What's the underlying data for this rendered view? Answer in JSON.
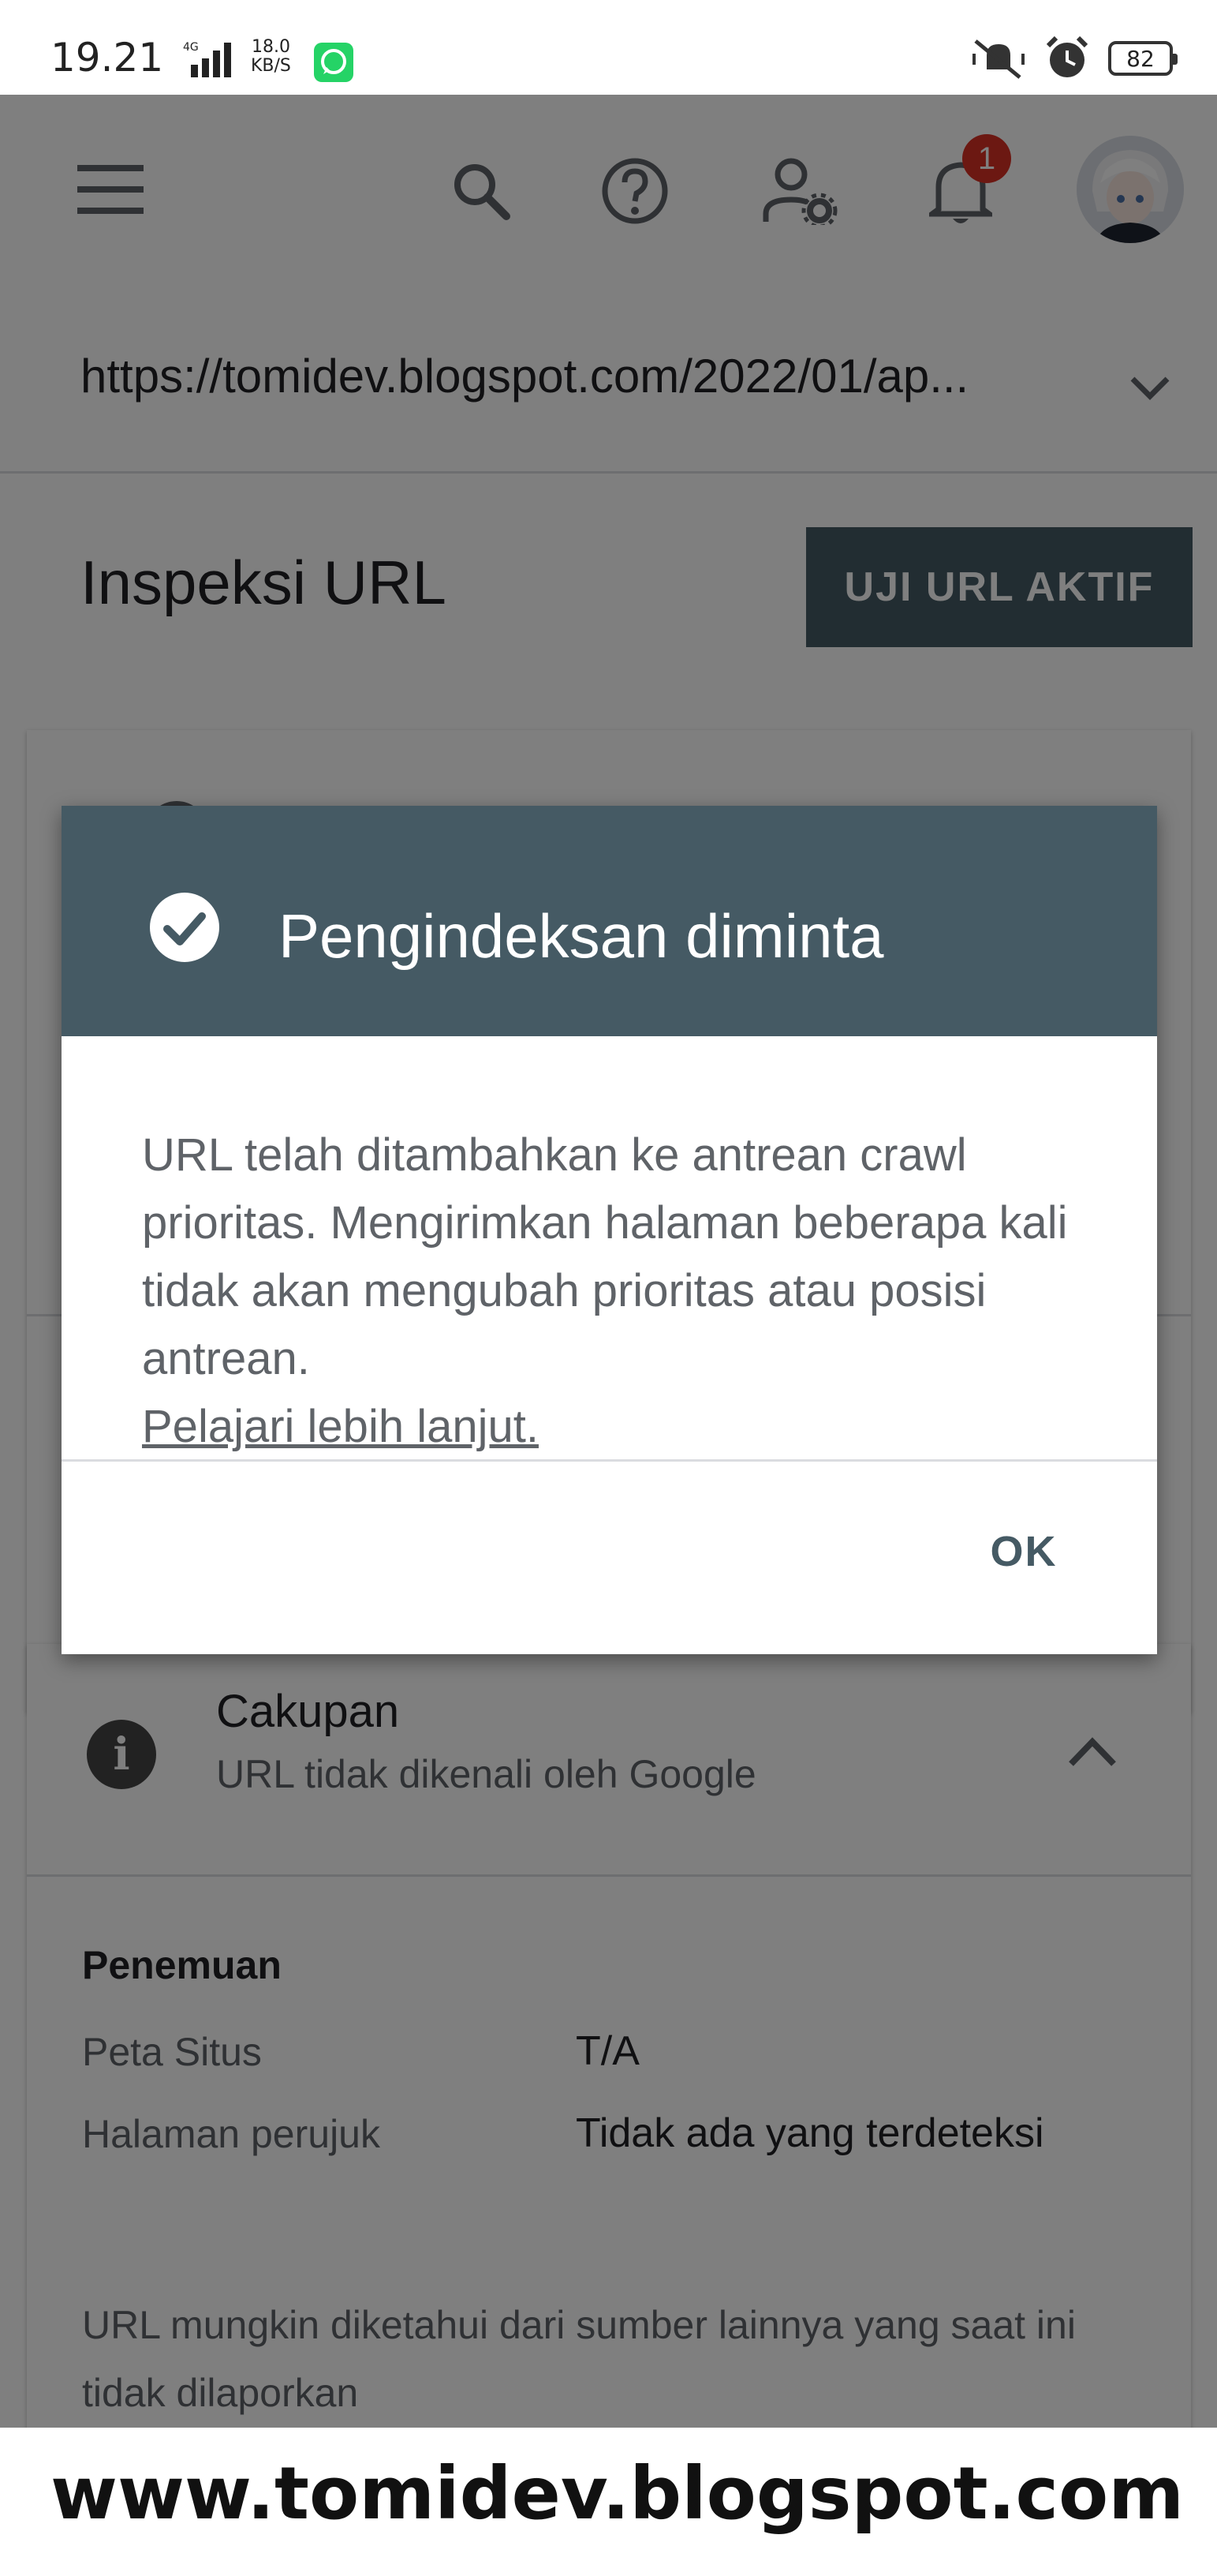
{
  "status_bar": {
    "time": "19.21",
    "network": "4G",
    "speed_value": "18.0",
    "speed_unit": "KB/S",
    "battery": "82"
  },
  "topbar": {
    "icons": [
      "menu-icon",
      "search-icon",
      "help-icon",
      "manage-user-icon",
      "notifications-icon",
      "avatar"
    ],
    "notification_count": "1"
  },
  "url_selector": {
    "value": "https://tomidev.blogspot.com/2022/01/ap..."
  },
  "page": {
    "title": "Inspeksi URL",
    "test_live_button": "UJI URL AKTIF"
  },
  "coverage": {
    "title": "Cakupan",
    "subtitle": "URL tidak dikenali oleh Google",
    "discovery": {
      "title": "Penemuan",
      "rows": [
        {
          "label": "Peta Situs",
          "value": "T/A"
        },
        {
          "label": "Halaman perujuk",
          "value": "Tidak ada yang terdeteksi"
        }
      ],
      "note": "URL mungkin diketahui dari sumber lainnya yang saat ini tidak dilaporkan"
    }
  },
  "dialog": {
    "title": "Pengindeksan diminta",
    "body": "URL telah ditambahkan ke antrean crawl prioritas. Mengirimkan halaman beberapa kali tidak akan mengubah prioritas atau posisi antrean.",
    "link": "Pelajari lebih lanjut.",
    "ok_button": "OK"
  },
  "watermark": "www.tomidev.blogspot.com",
  "colors": {
    "dialog_header": "#455a64",
    "button_dark": "#455a64",
    "badge": "#d93025",
    "scrim": "rgba(0,0,0,0.5)"
  }
}
